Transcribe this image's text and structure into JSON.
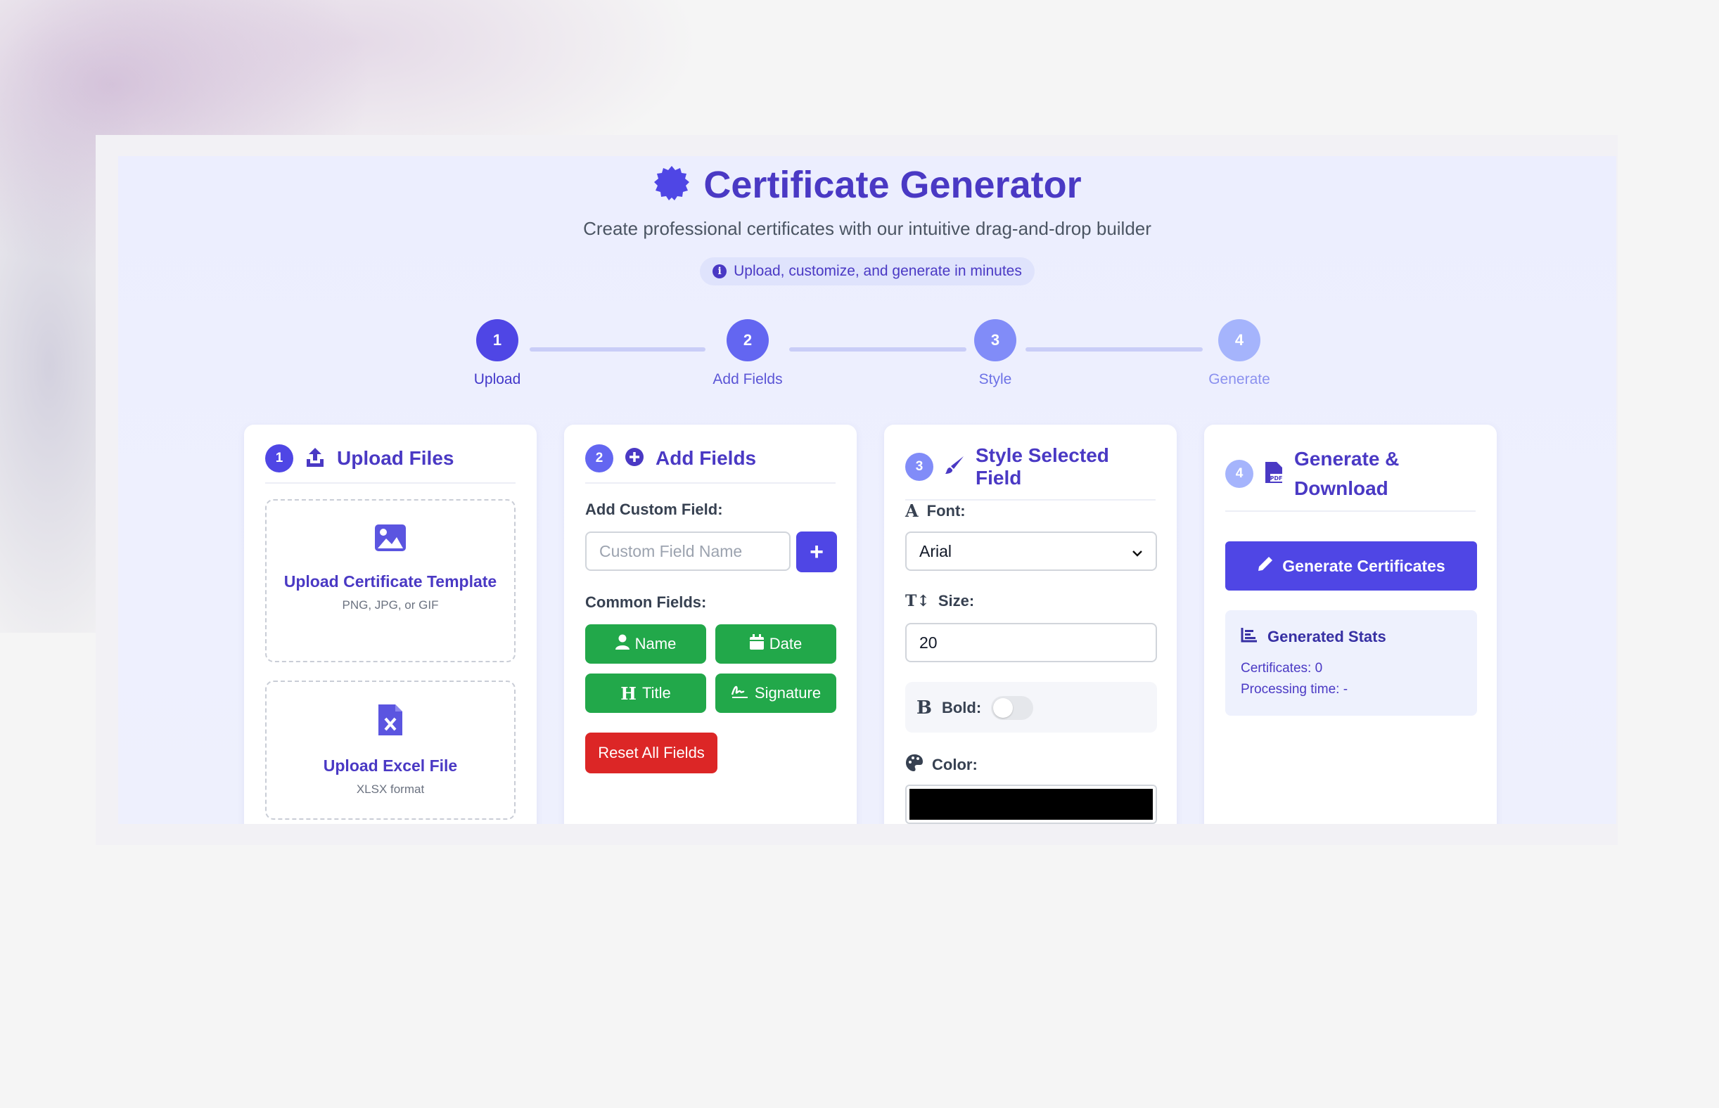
{
  "header": {
    "title": "Certificate Generator",
    "subtitle": "Create professional certificates with our intuitive drag-and-drop builder",
    "pill": "Upload, customize, and generate in minutes"
  },
  "steps": [
    {
      "number": "1",
      "label": "Upload"
    },
    {
      "number": "2",
      "label": "Add Fields"
    },
    {
      "number": "3",
      "label": "Style"
    },
    {
      "number": "4",
      "label": "Generate"
    }
  ],
  "upload": {
    "badge": "1",
    "title": "Upload Files",
    "template_title": "Upload Certificate Template",
    "template_formats": "PNG, JPG, or GIF",
    "excel_title": "Upload Excel File",
    "excel_format": "XLSX format"
  },
  "fields": {
    "badge": "2",
    "title": "Add Fields",
    "custom_label": "Add Custom Field:",
    "custom_placeholder": "Custom Field Name",
    "add_button": "+",
    "common_label": "Common Fields:",
    "buttons": {
      "name": "Name",
      "date": "Date",
      "title": "Title",
      "signature": "Signature"
    },
    "reset": "Reset All Fields"
  },
  "style": {
    "badge": "3",
    "title": "Style Selected Field",
    "font_label": "Font:",
    "font_value": "Arial",
    "size_label": "Size:",
    "size_value": "20",
    "bold_label": "Bold:",
    "bold_on": false,
    "color_label": "Color:",
    "color_value": "#000000"
  },
  "generate": {
    "badge": "4",
    "title_line1": "Generate &",
    "title_line2": "Download",
    "button": "Generate Certificates",
    "stats_title": "Generated Stats",
    "certificates": "Certificates: 0",
    "processing": "Processing time: -"
  },
  "colors": {
    "accent": "#4a39c4",
    "step1": "#4f46e5",
    "step2": "#6366f1",
    "step3": "#818cf8",
    "step4": "#a5b4fc",
    "green": "#22a84a",
    "red": "#dc2626"
  }
}
